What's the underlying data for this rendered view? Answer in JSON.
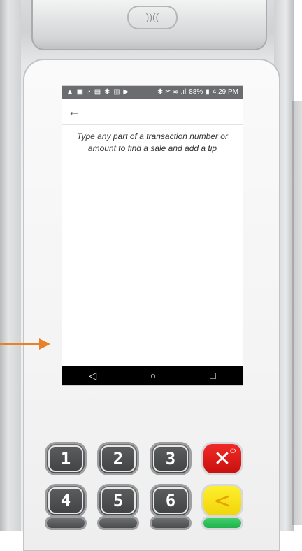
{
  "status_bar": {
    "left_icons": "▲ ▣ ◔ ▤ ✱ ▥ ▶",
    "right_icons": "✱ ✂ ≋ .ıl",
    "battery": "88%",
    "time": "4:29 PM"
  },
  "search": {
    "back_icon": "arrow-left-icon",
    "value": "",
    "placeholder": ""
  },
  "hint_text": "Type any part of a transaction number or amount to find a sale and add a tip",
  "nav_bar": {
    "back": "◁",
    "home": "○",
    "recents": "□"
  },
  "nfc_label": "))((",
  "keypad": {
    "keys": [
      "1",
      "2",
      "3",
      "4",
      "5",
      "6"
    ],
    "cancel_symbol": "✕",
    "power_symbol": "⏻",
    "clear_symbol": "<"
  },
  "colors": {
    "cancel": "#e8201c",
    "clear": "#f7e21a",
    "enter": "#2fc25a",
    "pointer": "#e8822a",
    "nav_bg": "#000000",
    "status_bg": "#6a6c70"
  }
}
